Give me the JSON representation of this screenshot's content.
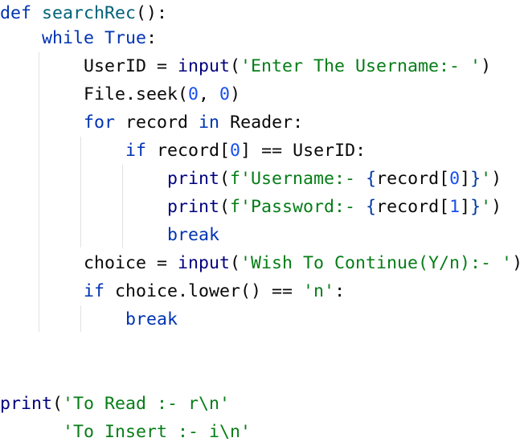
{
  "editor": {
    "colors": {
      "keyword": "#0033b3",
      "function": "#00627a",
      "builtin": "#000080",
      "string": "#067d17",
      "number": "#1750eb",
      "text": "#080808"
    },
    "lines": [
      [
        [
          "kw",
          "def"
        ],
        [
          "plain",
          " "
        ],
        [
          "fn",
          "searchRec"
        ],
        [
          "plain",
          "():"
        ]
      ],
      [
        [
          "plain",
          "    "
        ],
        [
          "kw",
          "while"
        ],
        [
          "plain",
          " "
        ],
        [
          "kw",
          "True"
        ],
        [
          "plain",
          ":"
        ]
      ],
      [
        [
          "plain",
          "        UserID = "
        ],
        [
          "bi",
          "input"
        ],
        [
          "plain",
          "("
        ],
        [
          "str",
          "'Enter The Username:- '"
        ],
        [
          "plain",
          ")"
        ]
      ],
      [
        [
          "plain",
          "        File.seek("
        ],
        [
          "num",
          "0"
        ],
        [
          "plain",
          ", "
        ],
        [
          "num",
          "0"
        ],
        [
          "plain",
          ")"
        ]
      ],
      [
        [
          "plain",
          "        "
        ],
        [
          "kw",
          "for"
        ],
        [
          "plain",
          " record "
        ],
        [
          "kw",
          "in"
        ],
        [
          "plain",
          " Reader:"
        ]
      ],
      [
        [
          "plain",
          "            "
        ],
        [
          "kw",
          "if"
        ],
        [
          "plain",
          " record["
        ],
        [
          "num",
          "0"
        ],
        [
          "plain",
          "] == UserID:"
        ]
      ],
      [
        [
          "plain",
          "                "
        ],
        [
          "bi",
          "print"
        ],
        [
          "plain",
          "("
        ],
        [
          "str",
          "f'Username:- "
        ],
        [
          "br",
          "{"
        ],
        [
          "plain",
          "record["
        ],
        [
          "num",
          "0"
        ],
        [
          "plain",
          "]"
        ],
        [
          "br",
          "}"
        ],
        [
          "str",
          "'"
        ],
        [
          "plain",
          ")"
        ]
      ],
      [
        [
          "plain",
          "                "
        ],
        [
          "bi",
          "print"
        ],
        [
          "plain",
          "("
        ],
        [
          "str",
          "f'Password:- "
        ],
        [
          "br",
          "{"
        ],
        [
          "plain",
          "record["
        ],
        [
          "num",
          "1"
        ],
        [
          "plain",
          "]"
        ],
        [
          "br",
          "}"
        ],
        [
          "str",
          "'"
        ],
        [
          "plain",
          ")"
        ]
      ],
      [
        [
          "plain",
          "                "
        ],
        [
          "kw",
          "break"
        ]
      ],
      [
        [
          "plain",
          "        choice = "
        ],
        [
          "bi",
          "input"
        ],
        [
          "plain",
          "("
        ],
        [
          "str",
          "'Wish To Continue(Y/n):- '"
        ],
        [
          "plain",
          ")"
        ]
      ],
      [
        [
          "plain",
          "        "
        ],
        [
          "kw",
          "if"
        ],
        [
          "plain",
          " choice.lower() == "
        ],
        [
          "str",
          "'n'"
        ],
        [
          "plain",
          ":"
        ]
      ],
      [
        [
          "plain",
          "            "
        ],
        [
          "kw",
          "break"
        ]
      ],
      [],
      [],
      [
        [
          "bi",
          "print"
        ],
        [
          "plain",
          "("
        ],
        [
          "str",
          "'To Read :- r\\n'"
        ]
      ],
      [
        [
          "plain",
          "      "
        ],
        [
          "str",
          "'To Insert :- i\\n'"
        ]
      ]
    ]
  }
}
